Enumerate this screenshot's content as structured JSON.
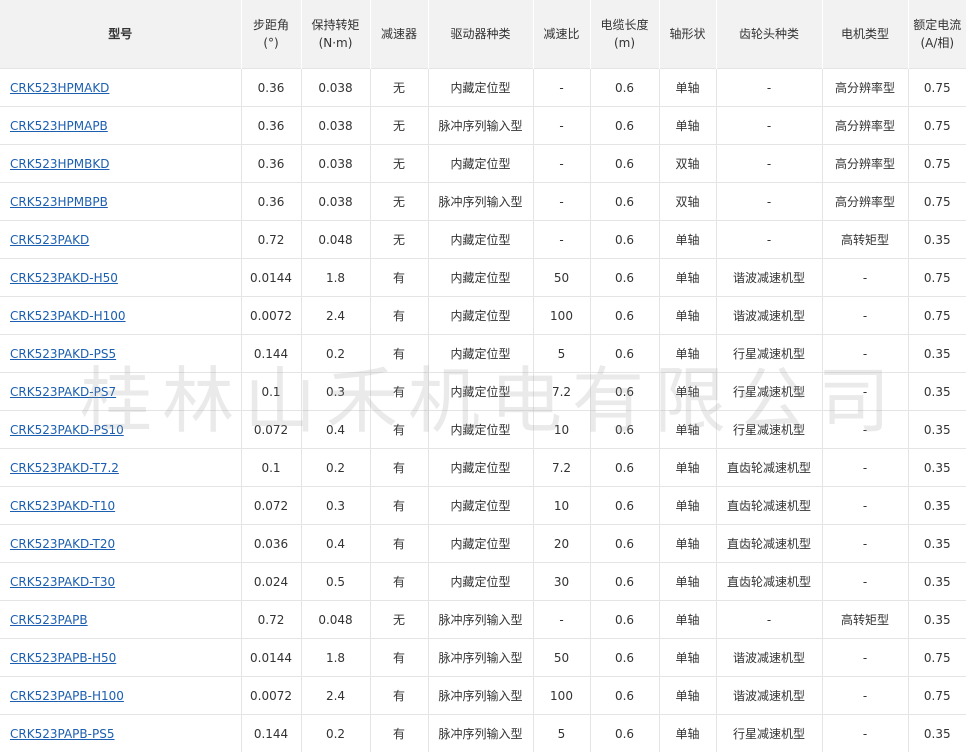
{
  "headers": [
    [
      "型号",
      ""
    ],
    [
      "步距角",
      "(°)"
    ],
    [
      "保持转矩",
      "(N·m)"
    ],
    [
      "减速器",
      ""
    ],
    [
      "驱动器种类",
      ""
    ],
    [
      "减速比",
      ""
    ],
    [
      "电缆长度",
      "(m)"
    ],
    [
      "轴形状",
      ""
    ],
    [
      "齿轮头种类",
      ""
    ],
    [
      "电机类型",
      ""
    ],
    [
      "额定电流",
      "(A/相)"
    ]
  ],
  "rows": [
    [
      "CRK523HPMAKD",
      "0.36",
      "0.038",
      "无",
      "内藏定位型",
      "-",
      "0.6",
      "单轴",
      "-",
      "高分辨率型",
      "0.75"
    ],
    [
      "CRK523HPMAPB",
      "0.36",
      "0.038",
      "无",
      "脉冲序列输入型",
      "-",
      "0.6",
      "单轴",
      "-",
      "高分辨率型",
      "0.75"
    ],
    [
      "CRK523HPMBKD",
      "0.36",
      "0.038",
      "无",
      "内藏定位型",
      "-",
      "0.6",
      "双轴",
      "-",
      "高分辨率型",
      "0.75"
    ],
    [
      "CRK523HPMBPB",
      "0.36",
      "0.038",
      "无",
      "脉冲序列输入型",
      "-",
      "0.6",
      "双轴",
      "-",
      "高分辨率型",
      "0.75"
    ],
    [
      "CRK523PAKD",
      "0.72",
      "0.048",
      "无",
      "内藏定位型",
      "-",
      "0.6",
      "单轴",
      "-",
      "高转矩型",
      "0.35"
    ],
    [
      "CRK523PAKD-H50",
      "0.0144",
      "1.8",
      "有",
      "内藏定位型",
      "50",
      "0.6",
      "单轴",
      "谐波减速机型",
      "-",
      "0.75"
    ],
    [
      "CRK523PAKD-H100",
      "0.0072",
      "2.4",
      "有",
      "内藏定位型",
      "100",
      "0.6",
      "单轴",
      "谐波减速机型",
      "-",
      "0.75"
    ],
    [
      "CRK523PAKD-PS5",
      "0.144",
      "0.2",
      "有",
      "内藏定位型",
      "5",
      "0.6",
      "单轴",
      "行星减速机型",
      "-",
      "0.35"
    ],
    [
      "CRK523PAKD-PS7",
      "0.1",
      "0.3",
      "有",
      "内藏定位型",
      "7.2",
      "0.6",
      "单轴",
      "行星减速机型",
      "-",
      "0.35"
    ],
    [
      "CRK523PAKD-PS10",
      "0.072",
      "0.4",
      "有",
      "内藏定位型",
      "10",
      "0.6",
      "单轴",
      "行星减速机型",
      "-",
      "0.35"
    ],
    [
      "CRK523PAKD-T7.2",
      "0.1",
      "0.2",
      "有",
      "内藏定位型",
      "7.2",
      "0.6",
      "单轴",
      "直齿轮减速机型",
      "-",
      "0.35"
    ],
    [
      "CRK523PAKD-T10",
      "0.072",
      "0.3",
      "有",
      "内藏定位型",
      "10",
      "0.6",
      "单轴",
      "直齿轮减速机型",
      "-",
      "0.35"
    ],
    [
      "CRK523PAKD-T20",
      "0.036",
      "0.4",
      "有",
      "内藏定位型",
      "20",
      "0.6",
      "单轴",
      "直齿轮减速机型",
      "-",
      "0.35"
    ],
    [
      "CRK523PAKD-T30",
      "0.024",
      "0.5",
      "有",
      "内藏定位型",
      "30",
      "0.6",
      "单轴",
      "直齿轮减速机型",
      "-",
      "0.35"
    ],
    [
      "CRK523PAPB",
      "0.72",
      "0.048",
      "无",
      "脉冲序列输入型",
      "-",
      "0.6",
      "单轴",
      "-",
      "高转矩型",
      "0.35"
    ],
    [
      "CRK523PAPB-H50",
      "0.0144",
      "1.8",
      "有",
      "脉冲序列输入型",
      "50",
      "0.6",
      "单轴",
      "谐波减速机型",
      "-",
      "0.75"
    ],
    [
      "CRK523PAPB-H100",
      "0.0072",
      "2.4",
      "有",
      "脉冲序列输入型",
      "100",
      "0.6",
      "单轴",
      "谐波减速机型",
      "-",
      "0.75"
    ],
    [
      "CRK523PAPB-PS5",
      "0.144",
      "0.2",
      "有",
      "脉冲序列输入型",
      "5",
      "0.6",
      "单轴",
      "行星减速机型",
      "-",
      "0.35"
    ]
  ],
  "watermark": "桂林山禾机电有限公司",
  "colors": {
    "link": "#1c5fb0",
    "header_bg": "#f2f2f2",
    "border": "#e4e4e4"
  }
}
